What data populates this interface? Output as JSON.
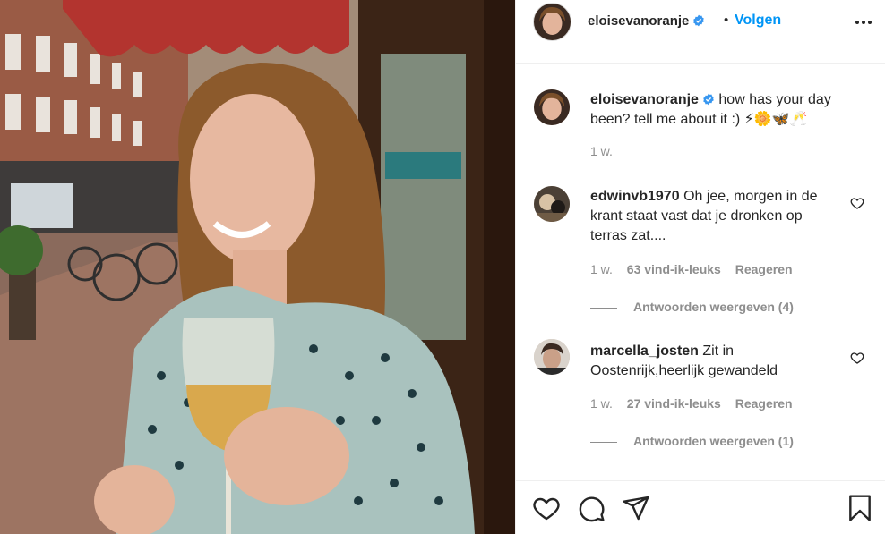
{
  "post": {
    "photo_description_icon": "photo"
  },
  "header": {
    "username": "eloisevanoranje",
    "separator": "•",
    "follow_label": "Volgen",
    "more_icon": "more-horizontal-icon"
  },
  "caption": {
    "username": "eloisevanoranje",
    "text": "how has your day been? tell me about it :) ⚡🌼🦋🥂",
    "time": "1 w."
  },
  "comments": [
    {
      "username": "edwinvb1970",
      "text": "Oh jee, morgen in de krant staat vast dat je dronken op terras zat....",
      "time": "1 w.",
      "likes": "63 vind-ik-leuks",
      "reply_label": "Reageren",
      "view_replies": "Antwoorden weergeven (4)"
    },
    {
      "username": "marcella_josten",
      "text": "Zit in Oostenrijk,heerlijk gewandeld",
      "time": "1 w.",
      "likes": "27 vind-ik-leuks",
      "reply_label": "Reageren",
      "view_replies": "Antwoorden weergeven (1)"
    }
  ],
  "actions": {
    "like_icon": "heart-icon",
    "comment_icon": "comment-icon",
    "share_icon": "paper-plane-icon",
    "save_icon": "bookmark-icon"
  },
  "colors": {
    "accent": "#0095f6",
    "text": "#262626",
    "muted": "#8e8e8e",
    "border": "#efefef"
  }
}
